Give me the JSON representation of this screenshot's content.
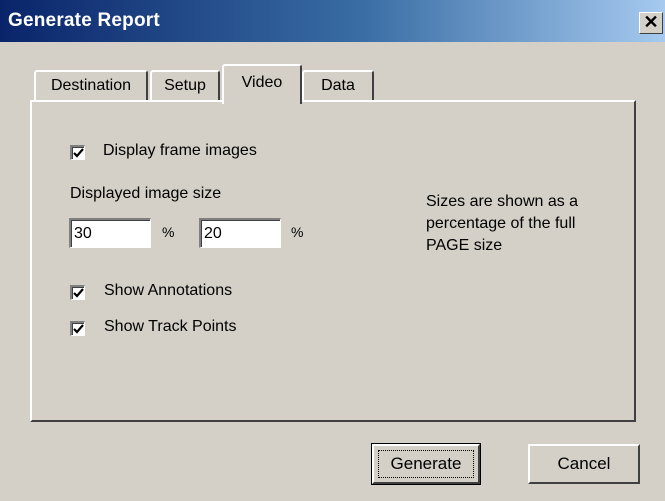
{
  "window": {
    "title": "Generate Report",
    "close_glyph": "✕"
  },
  "tabs": [
    {
      "label": "Destination",
      "active": false
    },
    {
      "label": "Setup",
      "active": false
    },
    {
      "label": "Video",
      "active": true
    },
    {
      "label": "Data",
      "active": false
    }
  ],
  "video": {
    "display_frame_images": {
      "label": "Display frame images",
      "checked": true
    },
    "image_size_label": "Displayed image size",
    "width_value": "30",
    "height_value": "20",
    "percent_symbol": "%",
    "info_lines": [
      "Sizes are shown as a",
      "percentage of the full",
      "PAGE size"
    ],
    "show_annotations": {
      "label": "Show Annotations",
      "checked": true
    },
    "show_track_points": {
      "label": "Show Track Points",
      "checked": true
    }
  },
  "buttons": {
    "generate": "Generate",
    "cancel": "Cancel"
  }
}
